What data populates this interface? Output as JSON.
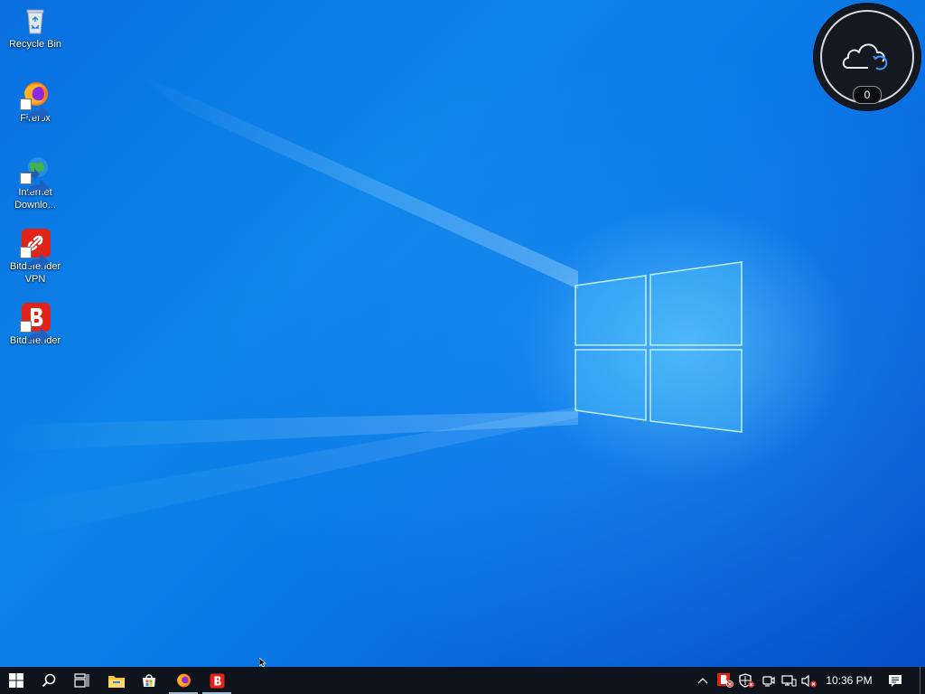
{
  "desktop": {
    "icons": [
      {
        "label": "Recycle Bin",
        "icon": "recycle-bin-icon"
      },
      {
        "label": "Firefox",
        "icon": "firefox-icon"
      },
      {
        "label": "Internet\nDownlo...",
        "icon": "internet-download-manager-icon"
      },
      {
        "label": "Bitdefender\nVPN",
        "icon": "bitdefender-vpn-icon"
      },
      {
        "label": "Bitdefender",
        "icon": "bitdefender-icon"
      }
    ]
  },
  "cloud_widget": {
    "count": "0",
    "icon": "cloud-sync-icon"
  },
  "taskbar": {
    "pinned": [
      {
        "icon": "file-explorer-icon"
      },
      {
        "icon": "microsoft-store-icon"
      },
      {
        "icon": "firefox-icon",
        "active": true
      },
      {
        "icon": "bitdefender-icon",
        "active": true
      }
    ],
    "tray": {
      "icons": [
        "chevron-up-icon",
        "bitdefender-tray-icon",
        "windows-security-icon",
        "meet-now-icon",
        "network-icon",
        "volume-muted-icon"
      ],
      "time": "10:36 PM"
    }
  },
  "colors": {
    "bitdefender_red": "#e2231a",
    "taskbar": "#0f141c",
    "wallpaper_blue": "#0a74e4"
  }
}
